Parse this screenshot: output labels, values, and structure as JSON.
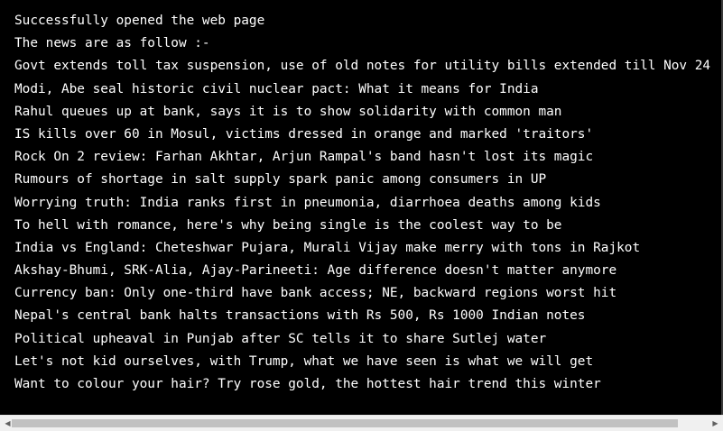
{
  "console": {
    "lines": [
      "Successfully opened the web page",
      "The news are as follow :-",
      "Govt extends toll tax suspension, use of old notes for utility bills extended till Nov 24",
      "Modi, Abe seal historic civil nuclear pact: What it means for India",
      "Rahul queues up at bank, says it is to show solidarity with common man",
      "IS kills over 60 in Mosul, victims dressed in orange and marked 'traitors'",
      "Rock On 2 review: Farhan Akhtar, Arjun Rampal's band hasn't lost its magic",
      "Rumours of shortage in salt supply spark panic among consumers in UP",
      "Worrying truth: India ranks first in pneumonia, diarrhoea deaths among kids",
      "To hell with romance, here's why being single is the coolest way to be",
      "India vs England: Cheteshwar Pujara, Murali Vijay make merry with tons in Rajkot",
      "Akshay-Bhumi, SRK-Alia, Ajay-Parineeti: Age difference doesn't matter anymore",
      "Currency ban: Only one-third have bank access; NE, backward regions worst hit",
      "Nepal's central bank halts transactions with Rs 500, Rs 1000 Indian notes",
      "Political upheaval in Punjab after SC tells it to share Sutlej water",
      "Let's not kid ourselves, with Trump, what we have seen is what we will get",
      "Want to colour your hair? Try rose gold, the hottest hair trend this winter"
    ]
  },
  "scrollbar": {
    "left_arrow": "◀",
    "right_arrow": "▶",
    "position": 0.0
  },
  "colors": {
    "background": "#000000",
    "text": "#ffffff",
    "scrollbar_track": "#f0f0f0",
    "scrollbar_thumb": "#c1c1c1"
  }
}
